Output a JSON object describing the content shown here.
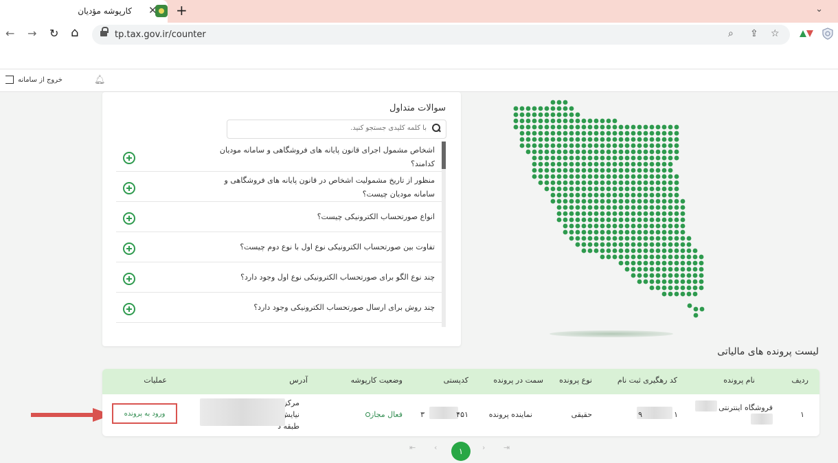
{
  "browser": {
    "tab_title": "کارپوشه مؤدیان",
    "close_glyph": "✕",
    "new_tab_glyph": "+",
    "menu_glyph": "⌄",
    "url": "tp.tax.gov.ir/counter",
    "back_glyph": "←",
    "forward_glyph": "→",
    "reload_glyph": "↻",
    "home_glyph": "⌂",
    "zoom_glyph": "⌕",
    "share_glyph": "⇪",
    "star_glyph": "☆"
  },
  "header": {
    "logout_label": "خروج از سامانه"
  },
  "faq": {
    "title": "سوالات متداول",
    "search_placeholder": "با کلمه کلیدی جستجو کنید.",
    "items": [
      {
        "question": "اشخاص مشمول اجرای قانون پایانه های فروشگاهی و سامانه مودیان کدامند؟"
      },
      {
        "question": "منظور از تاریخ مشمولیت اشخاص در قانون پایانه های فروشگاهی و سامانه مودیان چیست؟"
      },
      {
        "question": "انواع صورتحساب الکترونیکی چیست؟"
      },
      {
        "question": "تفاوت بین صورتحساب الکترونیکی نوع اول با نوع دوم چیست؟"
      },
      {
        "question": "چند نوع الگو برای صورتحساب الکترونیکی نوع اول وجود دارد؟"
      },
      {
        "question": "چند روش برای ارسال صورتحساب الکترونیکی وجود دارد؟"
      }
    ]
  },
  "taxfiles": {
    "title": "لیست پرونده های مالیاتی",
    "columns": {
      "row": "ردیف",
      "name": "نام پرونده",
      "tracking": "کد رهگیری ثبت نام",
      "type": "نوع پرونده",
      "role": "سمت در پرونده",
      "postal": "کدپستی",
      "status": "وضعیت کارپوشه",
      "address": "آدرس",
      "actions": "عملیات"
    },
    "rows": [
      {
        "row": "۱",
        "name": "فروشگاه اینترنتی",
        "tracking_start": "۱",
        "tracking_end": "۹",
        "type": "حقیقی",
        "role": "نماینده پرونده",
        "postal_start": "۳",
        "postal_end": "۴۵۱",
        "status": "فعال مجاز",
        "address_line1": "مرکزی",
        "address_line2": "نیایش",
        "address_line3": "طبقه د",
        "action_label": "ورود به پرونده"
      }
    ]
  },
  "pagination": {
    "first": "⇤",
    "prev": "‹",
    "current": "۱",
    "next": "›",
    "last": "⇥"
  },
  "colors": {
    "accent_green": "#28a745",
    "header_green": "#d9f1d6",
    "map_green": "#2e9a4e",
    "highlight_red": "#d9534f",
    "tab_strip": "#f9d9d2"
  }
}
